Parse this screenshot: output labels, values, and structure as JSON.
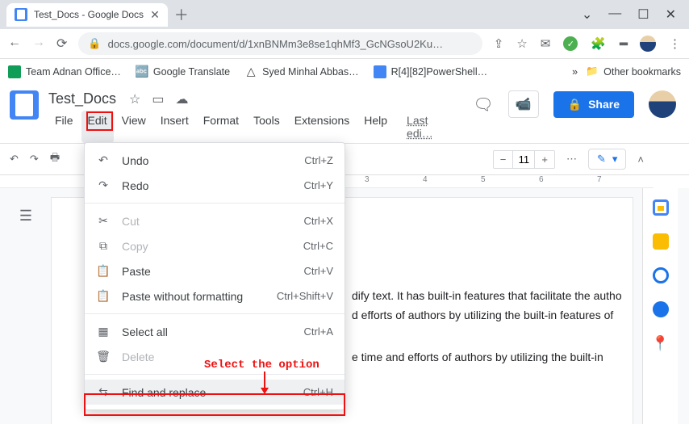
{
  "browser": {
    "tab_title": "Test_Docs - Google Docs",
    "url": "docs.google.com/document/d/1xnBNMm3e8se1qhMf3_GcNGsoU2Ku…"
  },
  "bookmarks": {
    "items": [
      "Team Adnan Office…",
      "Google Translate",
      "Syed Minhal Abbas…",
      "R[4][82]PowerShell…"
    ],
    "other": "Other bookmarks"
  },
  "docs": {
    "title": "Test_Docs",
    "menus": {
      "file": "File",
      "edit": "Edit",
      "view": "View",
      "insert": "Insert",
      "format": "Format",
      "tools": "Tools",
      "extensions": "Extensions",
      "help": "Help",
      "last_edit": "Last edi…"
    },
    "share": "Share"
  },
  "toolbar": {
    "fontsize": "11"
  },
  "ruler": {
    "t3": "3",
    "t4": "4",
    "t5": "5",
    "t6": "6",
    "t7": "7"
  },
  "document": {
    "line1": "dify text. It has built-in features that facilitate the autho",
    "line2": "d efforts of authors by utilizing the built-in features of",
    "line3": "e time and efforts of authors by utilizing the built-in"
  },
  "edit_menu": {
    "undo": {
      "label": "Undo",
      "sc": "Ctrl+Z"
    },
    "redo": {
      "label": "Redo",
      "sc": "Ctrl+Y"
    },
    "cut": {
      "label": "Cut",
      "sc": "Ctrl+X"
    },
    "copy": {
      "label": "Copy",
      "sc": "Ctrl+C"
    },
    "paste": {
      "label": "Paste",
      "sc": "Ctrl+V"
    },
    "paste_nf": {
      "label": "Paste without formatting",
      "sc": "Ctrl+Shift+V"
    },
    "sel_all": {
      "label": "Select all",
      "sc": "Ctrl+A"
    },
    "delete": {
      "label": "Delete",
      "sc": ""
    },
    "find": {
      "label": "Find and replace",
      "sc": "Ctrl+H"
    }
  },
  "annotation": {
    "text": "Select the option"
  }
}
